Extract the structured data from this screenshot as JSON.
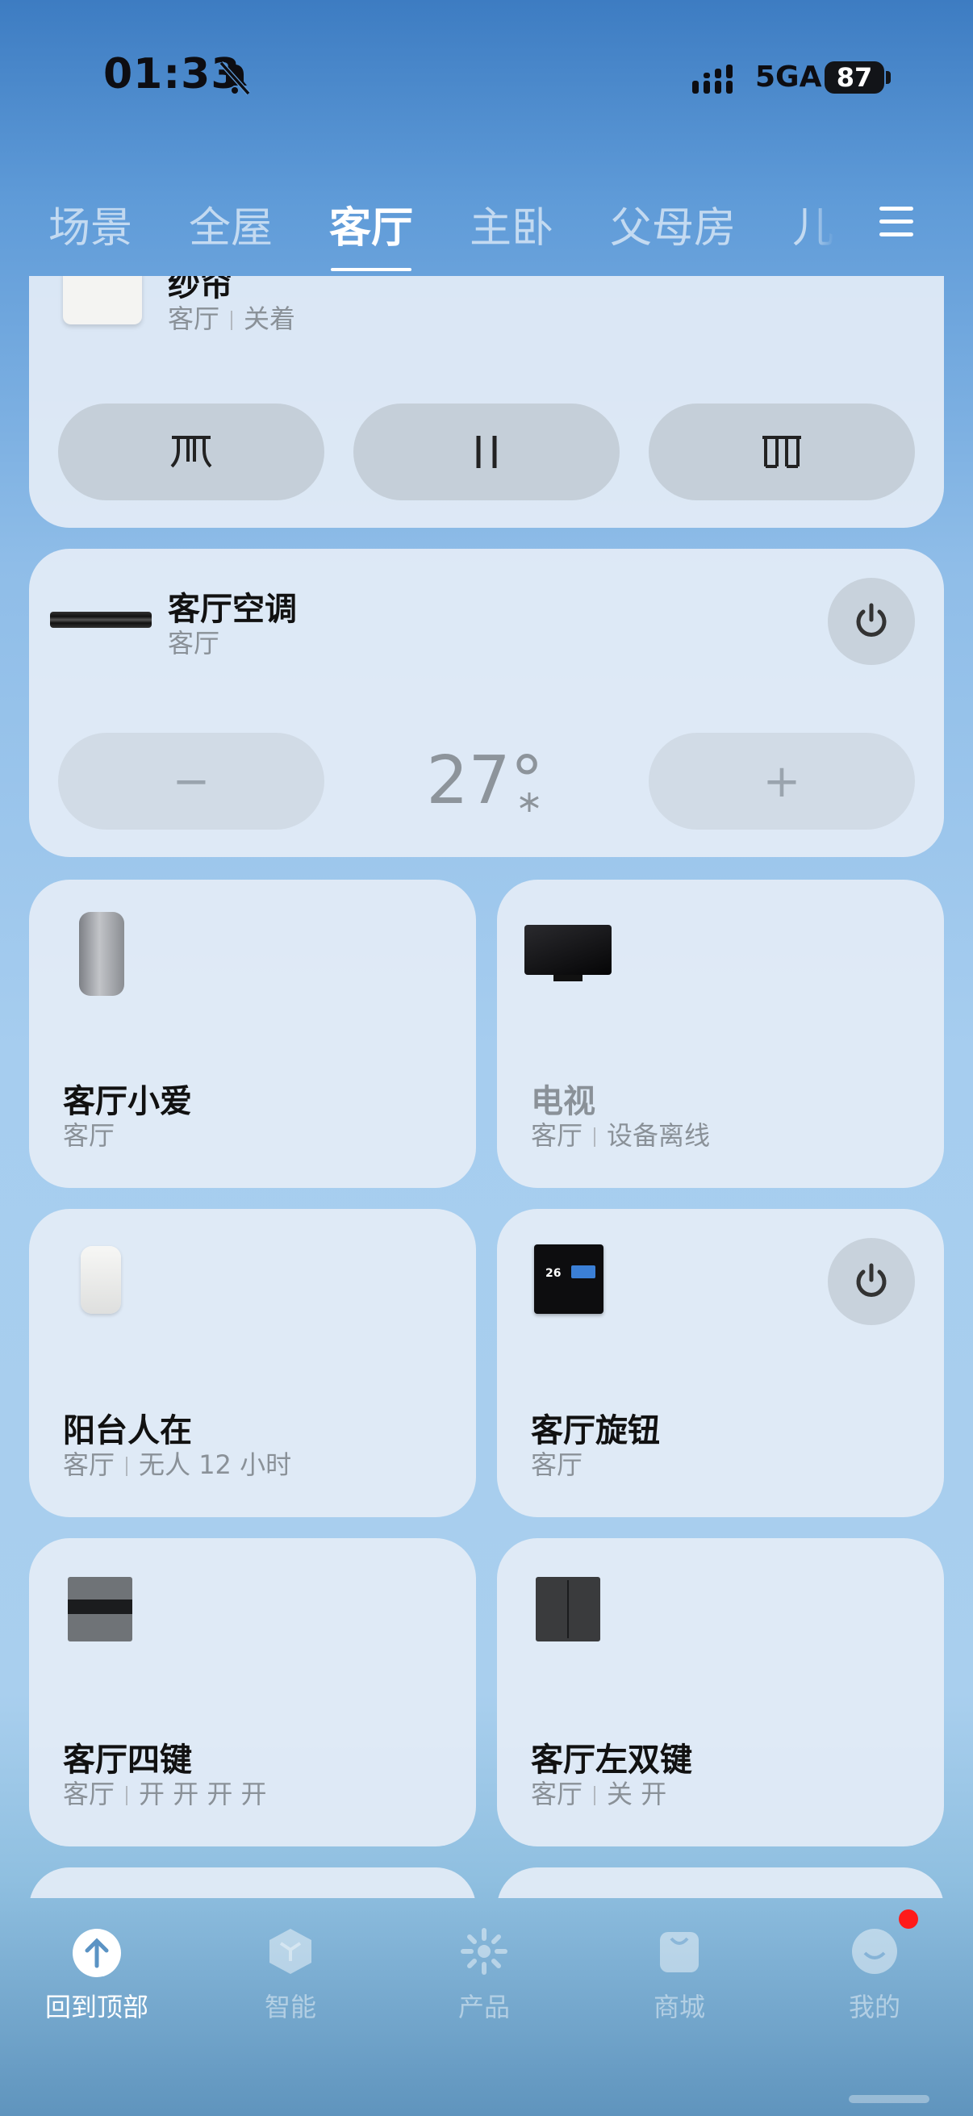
{
  "status_bar": {
    "time": "01:33",
    "network": "5GA",
    "battery": "87"
  },
  "tabs": [
    {
      "label": "场景"
    },
    {
      "label": "全屋"
    },
    {
      "label": "客厅"
    },
    {
      "label": "主卧"
    },
    {
      "label": "父母房"
    },
    {
      "label": "儿"
    }
  ],
  "active_tab": "客厅",
  "curtain": {
    "name": "纱帘",
    "room": "客厅",
    "state": "关着",
    "buttons": [
      {
        "label": "open"
      },
      {
        "label": "pause"
      },
      {
        "label": "close"
      }
    ]
  },
  "ac": {
    "name": "客厅空调",
    "room": "客厅",
    "temperature": "27°",
    "minus": "−",
    "plus": "+"
  },
  "devices": [
    {
      "name": "客厅小爱",
      "room": "客厅",
      "status": ""
    },
    {
      "name": "电视",
      "room": "客厅",
      "status": "设备离线"
    },
    {
      "name": "阳台人在",
      "room": "客厅",
      "status": "无人 12 小时"
    },
    {
      "name": "客厅旋钮",
      "room": "客厅",
      "status": ""
    },
    {
      "name": "客厅四键",
      "room": "客厅",
      "status": "开 开 开 开"
    },
    {
      "name": "客厅左双键",
      "room": "客厅",
      "status": "关 开"
    }
  ],
  "knob_screen_text": "26",
  "bottom_nav": [
    {
      "label": "回到顶部",
      "icon": "arrow-up-icon"
    },
    {
      "label": "智能",
      "icon": "cube-icon"
    },
    {
      "label": "产品",
      "icon": "sparkle-icon"
    },
    {
      "label": "商城",
      "icon": "bag-icon"
    },
    {
      "label": "我的",
      "icon": "face-icon"
    }
  ],
  "colors": {
    "accent": "#ffffff",
    "badge": "#ff1a1a"
  }
}
